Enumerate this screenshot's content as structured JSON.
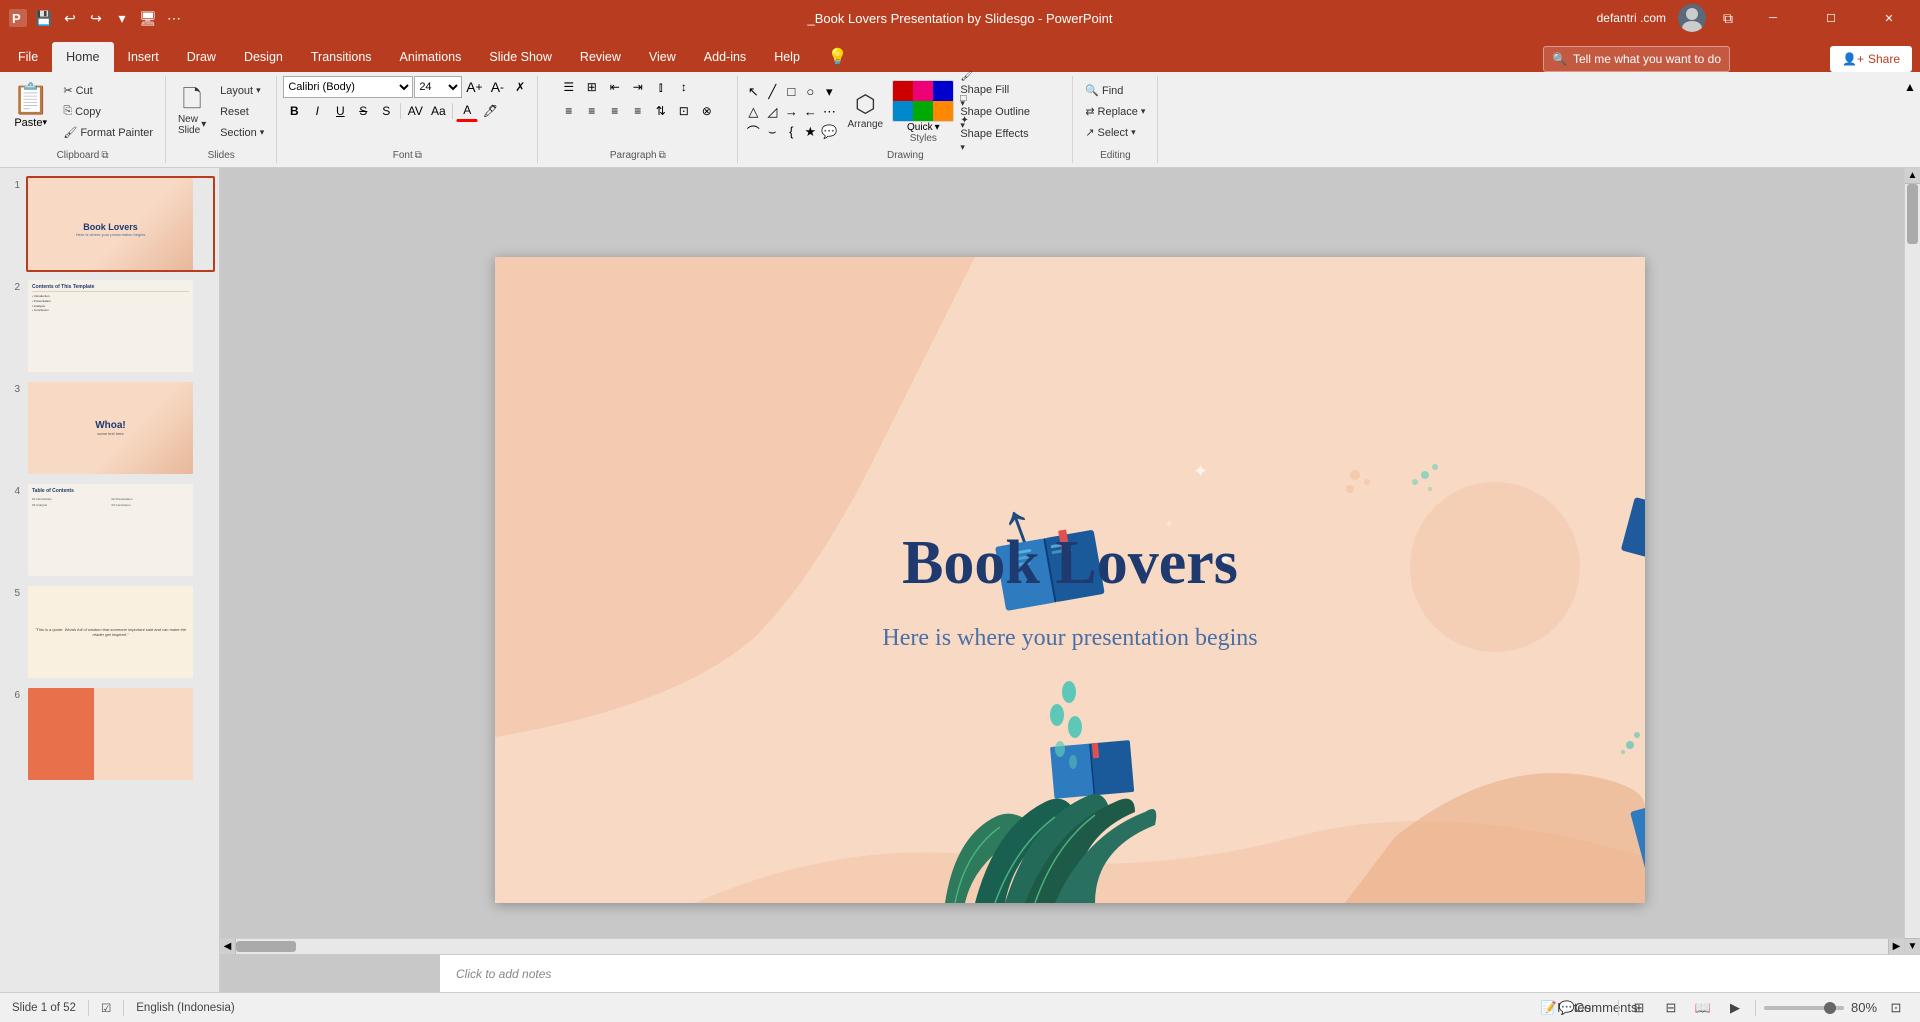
{
  "titlebar": {
    "title": "_Book Lovers Presentation by Slidesgo - PowerPoint",
    "user": "defantri .com",
    "save_label": "💾",
    "undo_label": "↩",
    "redo_label": "↪"
  },
  "ribbon": {
    "tabs": [
      {
        "id": "file",
        "label": "File"
      },
      {
        "id": "home",
        "label": "Home",
        "active": true
      },
      {
        "id": "insert",
        "label": "Insert"
      },
      {
        "id": "draw",
        "label": "Draw"
      },
      {
        "id": "design",
        "label": "Design"
      },
      {
        "id": "transitions",
        "label": "Transitions"
      },
      {
        "id": "animations",
        "label": "Animations"
      },
      {
        "id": "slideshow",
        "label": "Slide Show"
      },
      {
        "id": "review",
        "label": "Review"
      },
      {
        "id": "view",
        "label": "View"
      },
      {
        "id": "addins",
        "label": "Add-ins"
      },
      {
        "id": "help",
        "label": "Help"
      }
    ],
    "search_placeholder": "Tell me what you want to do",
    "share_label": "Share",
    "groups": {
      "clipboard": {
        "label": "Clipboard",
        "paste": "Paste",
        "cut": "Cut",
        "copy": "Copy",
        "format_painter": "Format Painter"
      },
      "slides": {
        "label": "Slides",
        "new_slide": "New\nSlide",
        "layout": "Layout",
        "reset": "Reset",
        "section": "Section"
      },
      "font": {
        "label": "Font",
        "font_name": "Calibri (Body)",
        "font_size": "24",
        "bold": "B",
        "italic": "I",
        "underline": "U",
        "strikethrough": "S",
        "shadow": "A",
        "increase_size": "A↑",
        "decrease_size": "A↓",
        "clear_format": "✗",
        "font_color": "A"
      },
      "paragraph": {
        "label": "Paragraph"
      },
      "drawing": {
        "label": "Drawing",
        "arrange": "Arrange",
        "quick_styles": "Quick\nStyles",
        "shape_fill": "Shape Fill",
        "shape_outline": "Shape Outline",
        "shape_effects": "Shape Effects"
      },
      "editing": {
        "label": "Editing",
        "find": "Find",
        "replace": "Replace",
        "select": "Select"
      }
    }
  },
  "slides": [
    {
      "num": "1",
      "type": "title",
      "label": "Book Lovers",
      "sublabel": "Here is where your presentation begins",
      "active": true
    },
    {
      "num": "2",
      "type": "content",
      "label": "Contents of This Template"
    },
    {
      "num": "3",
      "type": "whoa",
      "label": "Whoa!"
    },
    {
      "num": "4",
      "type": "toc",
      "label": "Table of Contents"
    },
    {
      "num": "5",
      "type": "quote",
      "label": ""
    },
    {
      "num": "6",
      "type": "color",
      "label": ""
    }
  ],
  "slide": {
    "title": "Book Lovers",
    "subtitle": "Here is where your presentation begins"
  },
  "notes": {
    "placeholder": "Click to add notes"
  },
  "statusbar": {
    "slide_info": "Slide 1 of 52",
    "language": "English (Indonesia)",
    "notes": "Notes",
    "comments": "Comments",
    "zoom": "80%"
  }
}
